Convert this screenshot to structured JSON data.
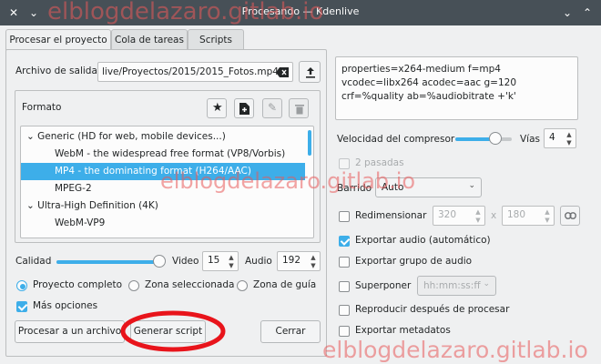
{
  "window": {
    "title": "Procesando — Kdenlive"
  },
  "titlebar_controls": {
    "close": "✕",
    "menu": "⌄",
    "minimize": "⌄",
    "restore": "⌃"
  },
  "tabs": [
    {
      "label": "Procesar el proyecto",
      "active": true
    },
    {
      "label": "Cola de tareas",
      "active": false
    },
    {
      "label": "Scripts",
      "active": false
    }
  ],
  "output": {
    "label": "Archivo de salida",
    "value": "live/Proyectos/2015/2015_Fotos.mp4"
  },
  "format": {
    "label": "Formato",
    "tree": [
      {
        "label": "Generic (HD for web, mobile devices...)",
        "level": 0,
        "expanded": true,
        "selected": false
      },
      {
        "label": "WebM - the widespread free format (VP8/Vorbis)",
        "level": 1,
        "selected": false
      },
      {
        "label": "MP4 - the dominating format (H264/AAC)",
        "level": 1,
        "selected": true
      },
      {
        "label": "MPEG-2",
        "level": 1,
        "selected": false
      },
      {
        "label": "Ultra-High Definition (4K)",
        "level": 0,
        "expanded": true,
        "selected": false
      },
      {
        "label": "WebM-VP9",
        "level": 1,
        "selected": false
      }
    ]
  },
  "quality": {
    "label": "Calidad",
    "video_label": "Video",
    "video_value": "15",
    "audio_label": "Audio",
    "audio_value": "192",
    "slider_value": 1.0
  },
  "scope": {
    "options": [
      {
        "label": "Proyecto completo",
        "checked": true
      },
      {
        "label": "Zona seleccionada",
        "checked": false
      },
      {
        "label": "Zona de guía",
        "checked": false
      }
    ]
  },
  "more_options": {
    "label": "Más opciones",
    "checked": true
  },
  "buttons": {
    "render_to_file": "Procesar a un archivo",
    "generate_script": "Generar script",
    "close": "Cerrar"
  },
  "params_text": "properties=x264-medium f=mp4 vcodec=libx264 acodec=aac g=120 crf=%quality ab=%audiobitrate +'k'",
  "encoder": {
    "speed_label": "Velocidad del compresor",
    "speed_value": 0.8,
    "threads_label": "Vías",
    "threads_value": "4"
  },
  "two_pass": {
    "label": "2 pasadas",
    "checked": false
  },
  "scanning": {
    "label": "Barrido",
    "value": "Auto"
  },
  "resize": {
    "label": "Redimensionar",
    "checked": false,
    "width": "320",
    "times": "x",
    "height": "180"
  },
  "export_audio": {
    "label": "Exportar audio (automático)",
    "checked": true
  },
  "export_audio_group": {
    "label": "Exportar grupo de audio",
    "checked": false
  },
  "overlay": {
    "label": "Superponer",
    "checked": false,
    "value": "hh:mm:ss:ff"
  },
  "play_after": {
    "label": "Reproducir después de procesar",
    "checked": false
  },
  "export_metadata": {
    "label": "Exportar metadatos",
    "checked": false
  },
  "watermark": {
    "text": "elblogdelazaro.gitlab.io"
  },
  "colors": {
    "accent": "#3daee9",
    "titlebar": "#475057",
    "window": "#eff0f1",
    "annotation": "#e8141b"
  }
}
